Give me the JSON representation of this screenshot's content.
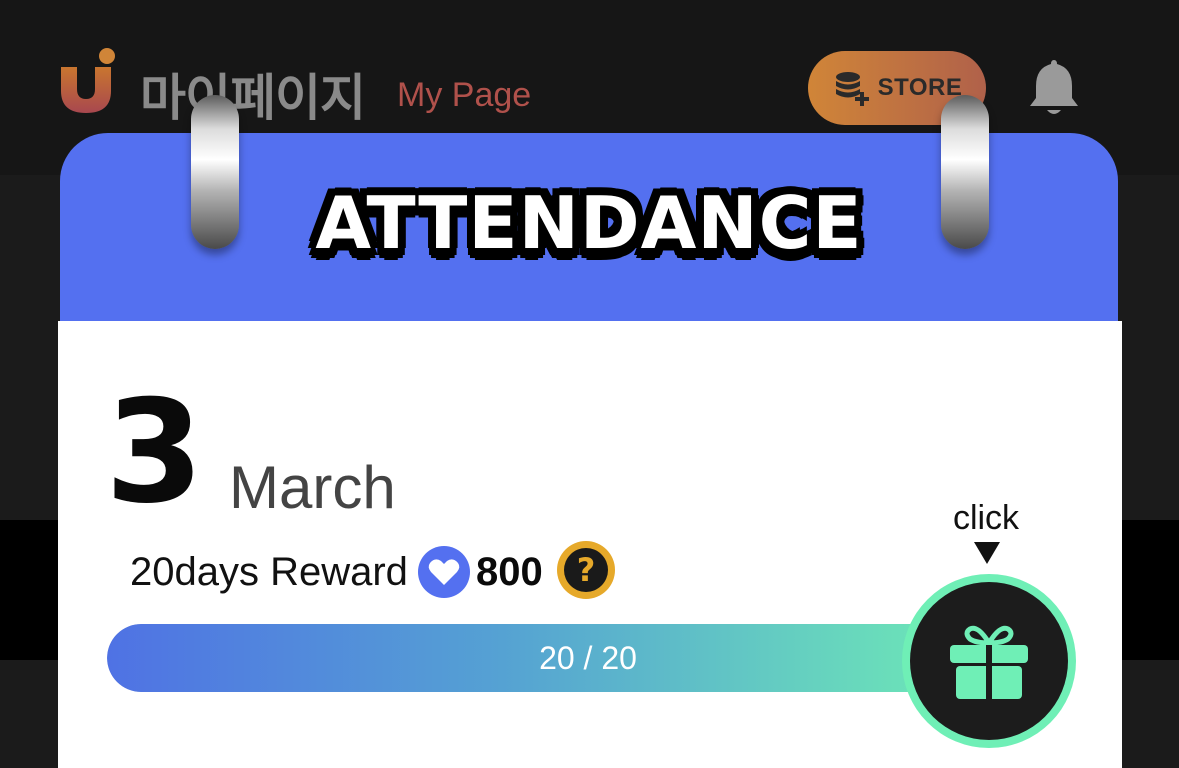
{
  "header": {
    "title_ko": "마이페이지",
    "title_en": "My Page",
    "store_label": "STORE",
    "logo_icon": "u-logo-icon",
    "store_icon": "coin-stack-plus-icon",
    "notification_icon": "bell-icon"
  },
  "calendar": {
    "title": "ATTENDANCE",
    "day": "3",
    "month": "March",
    "reward_label": "20days Reward",
    "reward_icon": "heart-icon",
    "reward_amount": "800",
    "help_label": "?",
    "progress_text": "20 / 20",
    "progress_fraction": 1.0,
    "click_hint": "click",
    "gift_icon": "gift-icon"
  },
  "colors": {
    "accent_blue": "#5470f0",
    "gift_green": "#6fefb6",
    "store_gradient_start": "#d08538",
    "help_gold": "#e6a92a"
  }
}
